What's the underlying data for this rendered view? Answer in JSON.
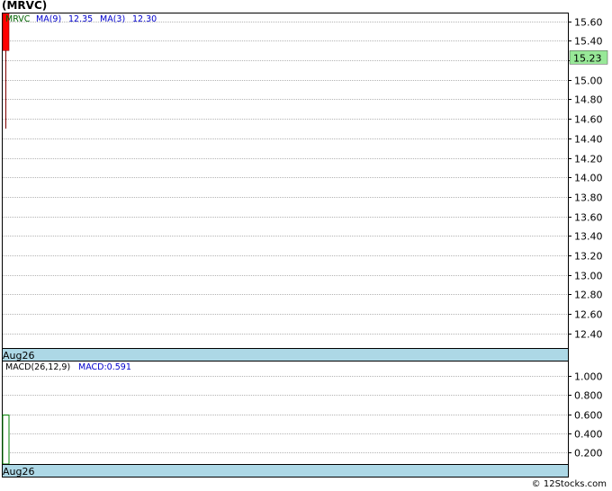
{
  "chart_data": [
    {
      "type": "candlestick",
      "title": "(MRVC)",
      "ticker": "MRVC",
      "legend": [
        {
          "label": "MRVC",
          "color": "#006400"
        },
        {
          "label": "MA(9)",
          "value": "12.35",
          "color": "#0000cc"
        },
        {
          "label": "MA(3)",
          "value": "12.30",
          "color": "#0000cc"
        }
      ],
      "ylim": [
        12.25,
        15.68
      ],
      "yticks": [
        15.6,
        15.4,
        15.2,
        15.0,
        14.8,
        14.6,
        14.4,
        14.2,
        14.0,
        13.8,
        13.6,
        13.4,
        13.2,
        13.0,
        12.8,
        12.6,
        12.4
      ],
      "ytick_labels": [
        "15.60",
        "15.40",
        "",
        "15.00",
        "14.80",
        "14.60",
        "14.40",
        "14.20",
        "14.00",
        "13.80",
        "13.60",
        "13.40",
        "13.20",
        "13.00",
        "12.80",
        "12.60",
        "12.40"
      ],
      "candles": [
        {
          "open": 15.68,
          "high": 15.68,
          "low": 14.5,
          "close": 15.3,
          "color": "#ff0000"
        }
      ],
      "last_price": "15.23",
      "last_price_value": 15.23,
      "last_price_color": "#98e898",
      "x_label": "Aug26",
      "grid": true
    },
    {
      "type": "bar",
      "title": "MACD(26,12,9)",
      "indicator_label": "MACD(26,12,9)",
      "macd_label": "MACD:0.591",
      "ylim": [
        0.08,
        1.15
      ],
      "yticks": [
        1.0,
        0.8,
        0.6,
        0.4,
        0.2
      ],
      "ytick_labels": [
        "1.000",
        "0.800",
        "0.600",
        "0.400",
        "0.200"
      ],
      "values": [
        0.591
      ],
      "bar_color": "#008000",
      "x_label": "Aug26",
      "grid": true
    }
  ],
  "footer": "© 12Stocks.com",
  "colors": {
    "axis_band": "#add8e6",
    "grid": "#c0c0c0"
  }
}
